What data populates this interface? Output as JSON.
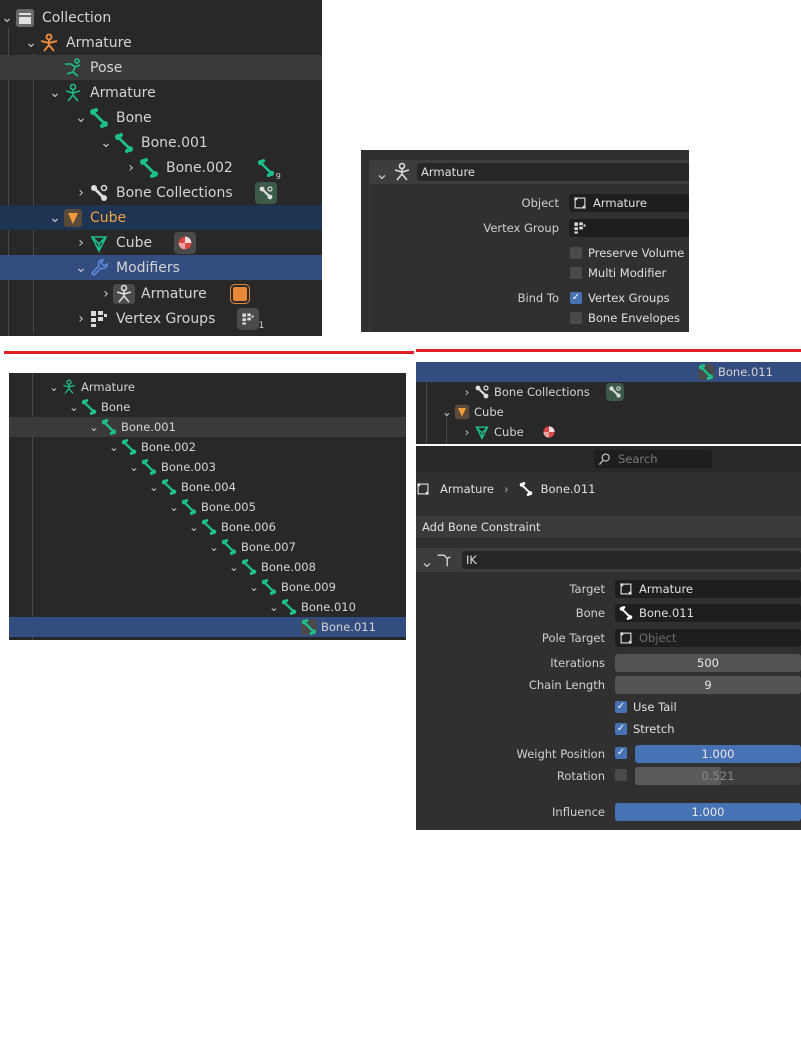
{
  "outliner_top": {
    "rows": [
      {
        "label": "Collection"
      },
      {
        "label": "Armature"
      },
      {
        "label": "Pose"
      },
      {
        "label": "Armature"
      },
      {
        "label": "Bone"
      },
      {
        "label": "Bone.001"
      },
      {
        "label": "Bone.002",
        "badge_count": "9"
      },
      {
        "label": "Bone Collections"
      },
      {
        "label": "Cube"
      },
      {
        "label": "Cube"
      },
      {
        "label": "Modifiers"
      },
      {
        "label": "Armature"
      },
      {
        "label": "Vertex Groups",
        "badge_count": "1"
      }
    ]
  },
  "modifier_panel": {
    "title": "Armature",
    "object_label": "Object",
    "object_value": "Armature",
    "vertex_group_label": "Vertex Group",
    "vertex_group_value": "",
    "preserve_volume": "Preserve Volume",
    "multi_modifier": "Multi Modifier",
    "bind_to_label": "Bind To",
    "vertex_groups": "Vertex Groups",
    "bone_envelopes": "Bone Envelopes"
  },
  "bone_chain": {
    "rows": [
      {
        "label": "Armature"
      },
      {
        "label": "Bone"
      },
      {
        "label": "Bone.001"
      },
      {
        "label": "Bone.002"
      },
      {
        "label": "Bone.003"
      },
      {
        "label": "Bone.004"
      },
      {
        "label": "Bone.005"
      },
      {
        "label": "Bone.006"
      },
      {
        "label": "Bone.007"
      },
      {
        "label": "Bone.008"
      },
      {
        "label": "Bone.009"
      },
      {
        "label": "Bone.010"
      },
      {
        "label": "Bone.011"
      }
    ]
  },
  "outliner_right": {
    "rows": [
      {
        "label": "Bone.011"
      },
      {
        "label": "Bone Collections"
      },
      {
        "label": "Cube"
      },
      {
        "label": "Cube"
      }
    ]
  },
  "bone_constraints": {
    "search_placeholder": "Search",
    "breadcrumb_object": "Armature",
    "breadcrumb_bone": "Bone.011",
    "add_label": "Add Bone Constraint",
    "constraint_name": "IK",
    "target_label": "Target",
    "target_value": "Armature",
    "bone_label": "Bone",
    "bone_value": "Bone.011",
    "pole_target_label": "Pole Target",
    "pole_target_placeholder": "Object",
    "iterations_label": "Iterations",
    "iterations_value": "500",
    "chain_length_label": "Chain Length",
    "chain_length_value": "9",
    "use_tail": "Use Tail",
    "stretch": "Stretch",
    "weight_position_label": "Weight Position",
    "weight_position_value": "1.000",
    "rotation_label": "Rotation",
    "rotation_value": "0.521",
    "rotation_fraction": 0.521,
    "influence_label": "Influence",
    "influence_value": "1.000"
  },
  "colors": {
    "bone_green": "#1dbf8e",
    "selection_blue": "#334d80",
    "active_orange": "#f0a640",
    "red_divider": "#e01e24"
  }
}
